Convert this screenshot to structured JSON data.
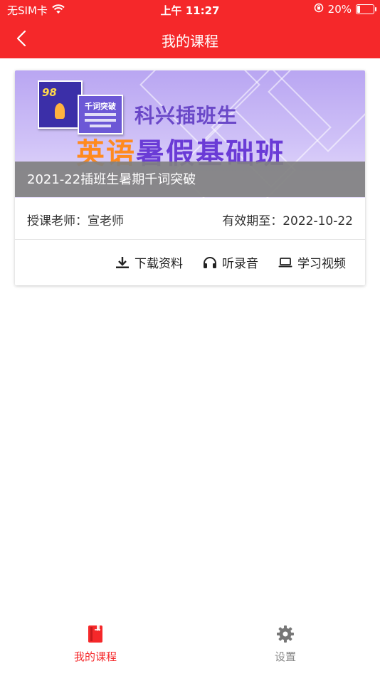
{
  "status_bar": {
    "carrier": "无SIM卡",
    "time": "上午 11:27",
    "battery": "20%",
    "battery_level": 0.2
  },
  "nav": {
    "title": "我的课程",
    "back_icon": "chevron-left-icon"
  },
  "course": {
    "banner": {
      "subtitle": "科兴插班生",
      "title_highlight": "英语",
      "title_rest": "暑假基础班",
      "book1_number": "98",
      "book2_title": "千词突破"
    },
    "caption": "2021-22插班生暑期千词突破",
    "teacher": "授课老师：宣老师",
    "expire": "有效期至：2022-10-22",
    "actions": [
      {
        "label": "下载资料",
        "icon": "download-icon"
      },
      {
        "label": "听录音",
        "icon": "headphones-icon"
      },
      {
        "label": "学习视频",
        "icon": "laptop-icon"
      }
    ]
  },
  "tabbar": {
    "items": [
      {
        "label": "我的课程",
        "icon": "book-icon",
        "active": true
      },
      {
        "label": "设置",
        "icon": "gear-icon",
        "active": false
      }
    ]
  },
  "colors": {
    "brand_red": "#f5282a",
    "caption_gray": "#808080"
  }
}
